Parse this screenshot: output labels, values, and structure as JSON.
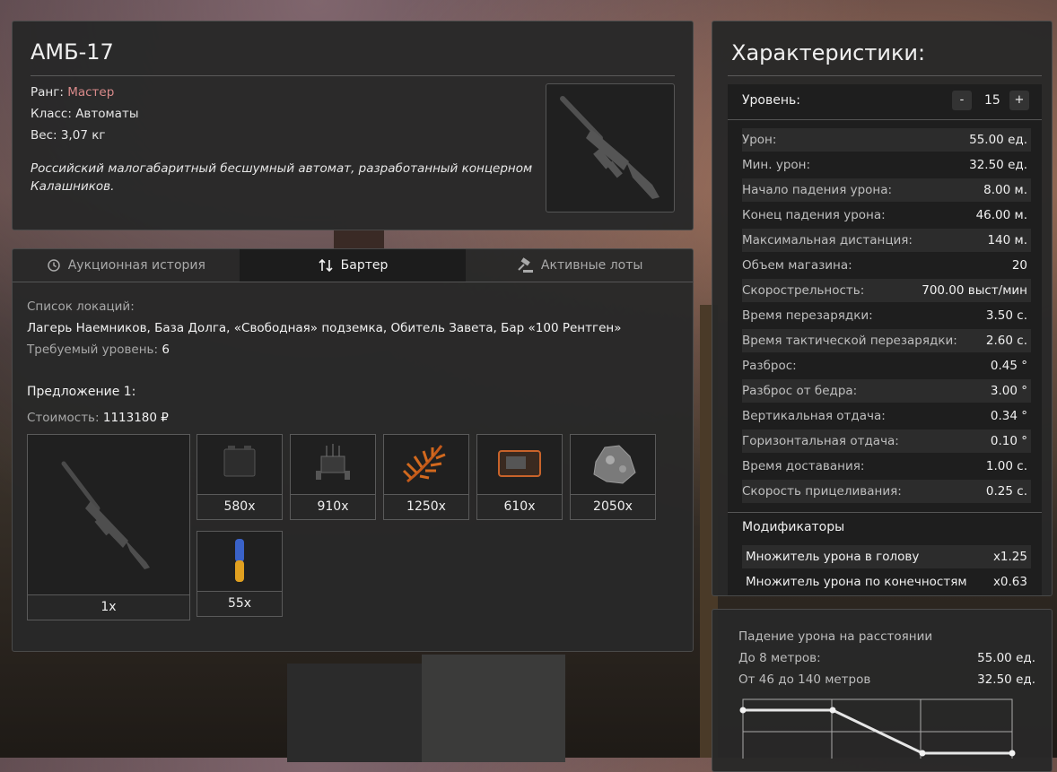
{
  "item": {
    "name": "АМБ-17",
    "rank_label": "Ранг:",
    "rank_value": "Мастер",
    "class_label": "Класс:",
    "class_value": "Автоматы",
    "weight_label": "Вес:",
    "weight_value": "3,07 кг",
    "description": "Российский малогабаритный бесшумный автомат, разработанный концерном Калашников."
  },
  "tabs": [
    {
      "label": "Аукционная история",
      "icon": "history-icon",
      "active": false
    },
    {
      "label": "Бартер",
      "icon": "swap-icon",
      "active": true
    },
    {
      "label": "Активные лоты",
      "icon": "gavel-icon",
      "active": false
    }
  ],
  "barter": {
    "locations_label": "Список локаций:",
    "locations": "Лагерь Наемников, База Долга, «Свободная» подземка, Обитель Завета, Бар «100 Рентген»",
    "required_level_label": "Требуемый уровень:",
    "required_level": "6",
    "offer_title": "Предложение 1:",
    "cost_label": "Стоимость:",
    "cost_value": "1113180 ₽",
    "result_qty": "1x",
    "ingredients": [
      {
        "qty": "580x",
        "icon": "battery-icon"
      },
      {
        "qty": "910x",
        "icon": "circuit-board-icon"
      },
      {
        "qty": "1250x",
        "icon": "fern-icon"
      },
      {
        "qty": "610x",
        "icon": "device-icon"
      },
      {
        "qty": "2050x",
        "icon": "ore-icon"
      },
      {
        "qty": "55x",
        "icon": "vial-icon"
      }
    ]
  },
  "stats": {
    "title": "Характеристики:",
    "level_label": "Уровень:",
    "level_minus": "-",
    "level_value": "15",
    "level_plus": "+",
    "rows": [
      {
        "label": "Урон:",
        "value": "55.00 ед."
      },
      {
        "label": "Мин. урон:",
        "value": "32.50 ед."
      },
      {
        "label": "Начало падения урона:",
        "value": "8.00 м."
      },
      {
        "label": "Конец падения урона:",
        "value": "46.00 м."
      },
      {
        "label": "Максимальная дистанция:",
        "value": "140 м."
      },
      {
        "label": "Объем магазина:",
        "value": "20"
      },
      {
        "label": "Скорострельность:",
        "value": "700.00 выст/мин"
      },
      {
        "label": "Время перезарядки:",
        "value": "3.50 с."
      },
      {
        "label": "Время тактической перезарядки:",
        "value": "2.60 с."
      },
      {
        "label": "Разброс:",
        "value": "0.45 °"
      },
      {
        "label": "Разброс от бедра:",
        "value": "3.00 °"
      },
      {
        "label": "Вертикальная отдача:",
        "value": "0.34 °"
      },
      {
        "label": "Горизонтальная отдача:",
        "value": "0.10 °"
      },
      {
        "label": "Время доставания:",
        "value": "1.00 с."
      },
      {
        "label": "Скорость прицеливания:",
        "value": "0.25 с."
      }
    ],
    "modifiers_title": "Модификаторы",
    "modifiers": [
      {
        "label": "Множитель урона в голову",
        "value": "x1.25"
      },
      {
        "label": "Множитель урона по конечностям",
        "value": "x0.63"
      }
    ]
  },
  "falloff": {
    "title": "Падение урона на расстоянии",
    "rows": [
      {
        "label": "До 8 метров:",
        "value": "55.00 ед."
      },
      {
        "label": "От 46 до 140 метров",
        "value": "32.50 ед."
      }
    ]
  },
  "chart_data": {
    "type": "line",
    "x": [
      0,
      8,
      46,
      140
    ],
    "y": [
      55,
      55,
      32.5,
      32.5
    ]
  }
}
